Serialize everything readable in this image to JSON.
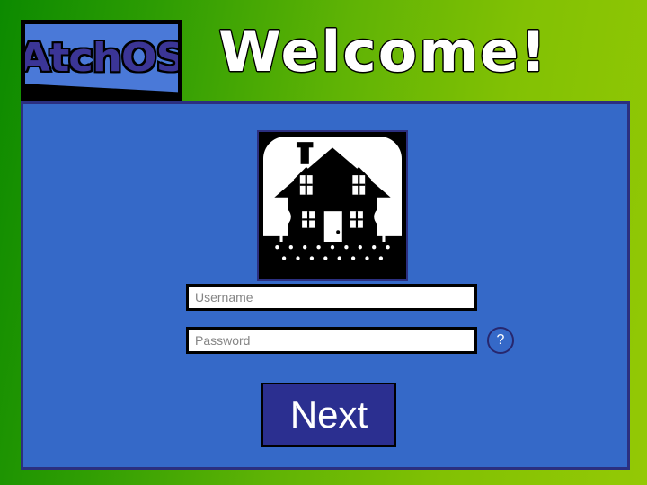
{
  "app": {
    "logo_text": "AtchOS",
    "headline": "Welcome!"
  },
  "colors": {
    "background_green_dark": "#0c8a00",
    "background_green_light": "#94c905",
    "panel_blue": "#3569c8",
    "panel_border": "#2b2f80",
    "logo_inner_blue": "#4a79d8",
    "logo_letter_fill": "#3b3596",
    "next_button_blue": "#2b2f90",
    "field_background": "#ffffff",
    "placeholder_gray": "#858585"
  },
  "panel": {
    "icon": {
      "name": "house-icon",
      "label": "house"
    },
    "username": {
      "name": "username-input",
      "placeholder": "Username",
      "value": ""
    },
    "password": {
      "name": "password-input",
      "placeholder": "Password",
      "value": ""
    },
    "help": {
      "name": "help-button",
      "label": "?"
    },
    "next": {
      "name": "next-button",
      "label": "Next"
    }
  }
}
